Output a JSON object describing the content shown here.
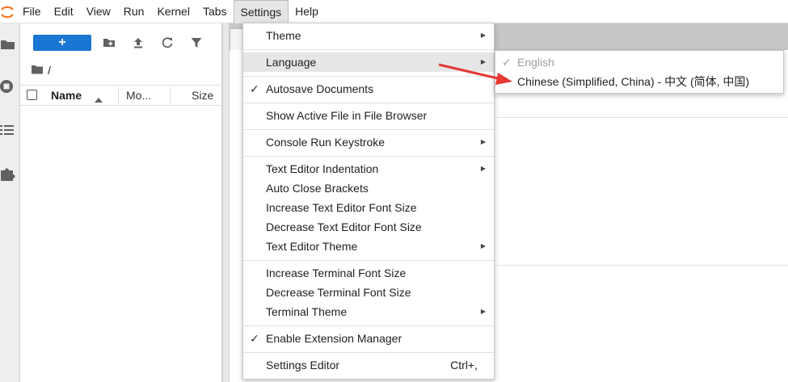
{
  "menubar": {
    "items": [
      "File",
      "Edit",
      "View",
      "Run",
      "Kernel",
      "Tabs",
      "Settings",
      "Help"
    ],
    "active": "Settings"
  },
  "filebrowser": {
    "new_label": "+",
    "breadcrumb": "/",
    "columns": {
      "name": "Name",
      "modified": "Mo...",
      "size": "Size"
    }
  },
  "settings_menu": {
    "theme": "Theme",
    "language": "Language",
    "autosave": "Autosave Documents",
    "show_active": "Show Active File in File Browser",
    "console_keystroke": "Console Run Keystroke",
    "indentation": "Text Editor Indentation",
    "auto_close": "Auto Close Brackets",
    "inc_editor_font": "Increase Text Editor Font Size",
    "dec_editor_font": "Decrease Text Editor Font Size",
    "editor_theme": "Text Editor Theme",
    "inc_terminal_font": "Increase Terminal Font Size",
    "dec_terminal_font": "Decrease Terminal Font Size",
    "terminal_theme": "Terminal Theme",
    "extension_manager": "Enable Extension Manager",
    "settings_editor": "Settings Editor",
    "settings_editor_shortcut": "Ctrl+,"
  },
  "language_submenu": {
    "english": "English",
    "chinese": "Chinese (Simplified, China) - 中文 (简体, 中国)"
  },
  "colors": {
    "accent": "#1976d2",
    "annotation_arrow": "#e53935"
  }
}
